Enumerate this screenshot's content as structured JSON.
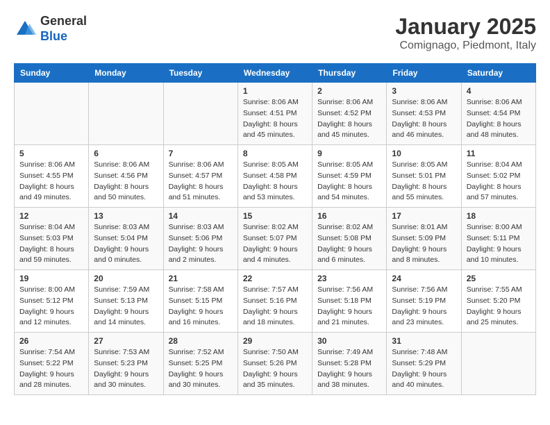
{
  "logo": {
    "general": "General",
    "blue": "Blue"
  },
  "header": {
    "month": "January 2025",
    "location": "Comignago, Piedmont, Italy"
  },
  "days_of_week": [
    "Sunday",
    "Monday",
    "Tuesday",
    "Wednesday",
    "Thursday",
    "Friday",
    "Saturday"
  ],
  "weeks": [
    [
      {
        "day": "",
        "info": ""
      },
      {
        "day": "",
        "info": ""
      },
      {
        "day": "",
        "info": ""
      },
      {
        "day": "1",
        "info": "Sunrise: 8:06 AM\nSunset: 4:51 PM\nDaylight: 8 hours\nand 45 minutes."
      },
      {
        "day": "2",
        "info": "Sunrise: 8:06 AM\nSunset: 4:52 PM\nDaylight: 8 hours\nand 45 minutes."
      },
      {
        "day": "3",
        "info": "Sunrise: 8:06 AM\nSunset: 4:53 PM\nDaylight: 8 hours\nand 46 minutes."
      },
      {
        "day": "4",
        "info": "Sunrise: 8:06 AM\nSunset: 4:54 PM\nDaylight: 8 hours\nand 48 minutes."
      }
    ],
    [
      {
        "day": "5",
        "info": "Sunrise: 8:06 AM\nSunset: 4:55 PM\nDaylight: 8 hours\nand 49 minutes."
      },
      {
        "day": "6",
        "info": "Sunrise: 8:06 AM\nSunset: 4:56 PM\nDaylight: 8 hours\nand 50 minutes."
      },
      {
        "day": "7",
        "info": "Sunrise: 8:06 AM\nSunset: 4:57 PM\nDaylight: 8 hours\nand 51 minutes."
      },
      {
        "day": "8",
        "info": "Sunrise: 8:05 AM\nSunset: 4:58 PM\nDaylight: 8 hours\nand 53 minutes."
      },
      {
        "day": "9",
        "info": "Sunrise: 8:05 AM\nSunset: 4:59 PM\nDaylight: 8 hours\nand 54 minutes."
      },
      {
        "day": "10",
        "info": "Sunrise: 8:05 AM\nSunset: 5:01 PM\nDaylight: 8 hours\nand 55 minutes."
      },
      {
        "day": "11",
        "info": "Sunrise: 8:04 AM\nSunset: 5:02 PM\nDaylight: 8 hours\nand 57 minutes."
      }
    ],
    [
      {
        "day": "12",
        "info": "Sunrise: 8:04 AM\nSunset: 5:03 PM\nDaylight: 8 hours\nand 59 minutes."
      },
      {
        "day": "13",
        "info": "Sunrise: 8:03 AM\nSunset: 5:04 PM\nDaylight: 9 hours\nand 0 minutes."
      },
      {
        "day": "14",
        "info": "Sunrise: 8:03 AM\nSunset: 5:06 PM\nDaylight: 9 hours\nand 2 minutes."
      },
      {
        "day": "15",
        "info": "Sunrise: 8:02 AM\nSunset: 5:07 PM\nDaylight: 9 hours\nand 4 minutes."
      },
      {
        "day": "16",
        "info": "Sunrise: 8:02 AM\nSunset: 5:08 PM\nDaylight: 9 hours\nand 6 minutes."
      },
      {
        "day": "17",
        "info": "Sunrise: 8:01 AM\nSunset: 5:09 PM\nDaylight: 9 hours\nand 8 minutes."
      },
      {
        "day": "18",
        "info": "Sunrise: 8:00 AM\nSunset: 5:11 PM\nDaylight: 9 hours\nand 10 minutes."
      }
    ],
    [
      {
        "day": "19",
        "info": "Sunrise: 8:00 AM\nSunset: 5:12 PM\nDaylight: 9 hours\nand 12 minutes."
      },
      {
        "day": "20",
        "info": "Sunrise: 7:59 AM\nSunset: 5:13 PM\nDaylight: 9 hours\nand 14 minutes."
      },
      {
        "day": "21",
        "info": "Sunrise: 7:58 AM\nSunset: 5:15 PM\nDaylight: 9 hours\nand 16 minutes."
      },
      {
        "day": "22",
        "info": "Sunrise: 7:57 AM\nSunset: 5:16 PM\nDaylight: 9 hours\nand 18 minutes."
      },
      {
        "day": "23",
        "info": "Sunrise: 7:56 AM\nSunset: 5:18 PM\nDaylight: 9 hours\nand 21 minutes."
      },
      {
        "day": "24",
        "info": "Sunrise: 7:56 AM\nSunset: 5:19 PM\nDaylight: 9 hours\nand 23 minutes."
      },
      {
        "day": "25",
        "info": "Sunrise: 7:55 AM\nSunset: 5:20 PM\nDaylight: 9 hours\nand 25 minutes."
      }
    ],
    [
      {
        "day": "26",
        "info": "Sunrise: 7:54 AM\nSunset: 5:22 PM\nDaylight: 9 hours\nand 28 minutes."
      },
      {
        "day": "27",
        "info": "Sunrise: 7:53 AM\nSunset: 5:23 PM\nDaylight: 9 hours\nand 30 minutes."
      },
      {
        "day": "28",
        "info": "Sunrise: 7:52 AM\nSunset: 5:25 PM\nDaylight: 9 hours\nand 30 minutes."
      },
      {
        "day": "29",
        "info": "Sunrise: 7:50 AM\nSunset: 5:26 PM\nDaylight: 9 hours\nand 35 minutes."
      },
      {
        "day": "30",
        "info": "Sunrise: 7:49 AM\nSunset: 5:28 PM\nDaylight: 9 hours\nand 38 minutes."
      },
      {
        "day": "31",
        "info": "Sunrise: 7:48 AM\nSunset: 5:29 PM\nDaylight: 9 hours\nand 40 minutes."
      },
      {
        "day": "",
        "info": ""
      }
    ]
  ]
}
